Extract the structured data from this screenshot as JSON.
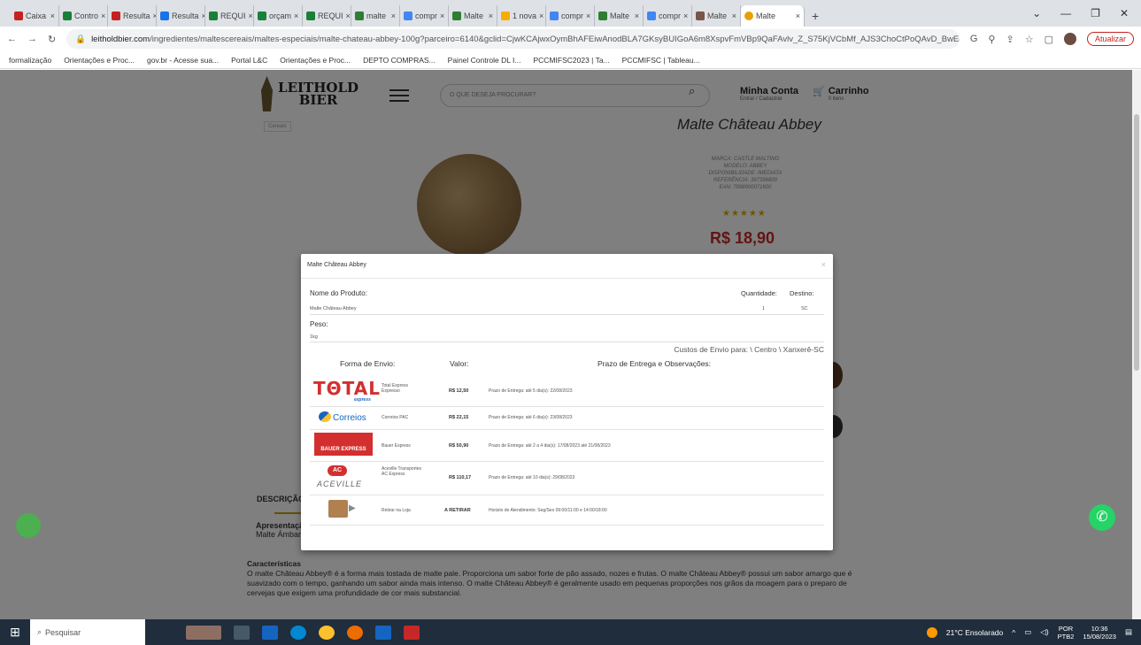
{
  "browser": {
    "tabs": [
      {
        "label": "Caixa"
      },
      {
        "label": "Contro"
      },
      {
        "label": "Resulta"
      },
      {
        "label": "Resulta"
      },
      {
        "label": "REQUI"
      },
      {
        "label": "orçam"
      },
      {
        "label": "REQUI"
      },
      {
        "label": "malte"
      },
      {
        "label": "compr"
      },
      {
        "label": "Malte"
      },
      {
        "label": "1 nova"
      },
      {
        "label": "compr"
      },
      {
        "label": "Malte"
      },
      {
        "label": "compr"
      },
      {
        "label": "Malte"
      },
      {
        "label": "Malte",
        "active": true
      }
    ],
    "url_domain": "leitholdbier.com",
    "url_rest": "/ingredientes/maltescereais/maltes-especiais/malte-chateau-abbey-100g?parceiro=6140&gclid=CjwKCAjwxOymBhAFEiwAnodBLA7GKsyBUIGoA6m8XspvFmVBp9QaFAvlv_Z_S75KjVCbMf_AJS3ChoCtPoQAvD_BwE&variant_...",
    "update_label": "Atualizar",
    "bookmarks": [
      "formalização",
      "Orientações e Proc...",
      "gov.br - Acesse sua...",
      "Portal L&C",
      "Orientações e Proc...",
      "DEPTO COMPRAS...",
      "Painel Controle DL I...",
      "PCCMIFSC2023 | Ta...",
      "PCCMIFSC | Tableau..."
    ]
  },
  "site": {
    "logo_line1": "LEITHOLD",
    "logo_line2": "BIER",
    "search_placeholder": "O QUE DESEJA PROCURAR?",
    "account_title": "Minha Conta",
    "account_sub": "Entrar / Cadastrar",
    "cart_title": "Carrinho",
    "cart_sub": "0 itens",
    "breadcrumb": "Cereais",
    "product_title": "Malte Château Abbey",
    "specs": [
      "MARCA: CASTLE MALTING",
      "MODELO: ABBEY",
      "DISPONIBILIDADE: IMEDIATA",
      "REFERÊNCIA: 397396800",
      "EAN: 7898900071600"
    ],
    "stars": "★★★★★",
    "price": "R$ 18,90",
    "desc_label": "DESCRIÇÃO",
    "apres_title": "Apresentação",
    "apres_text": "Malte Ámbar",
    "caract_title": "Características",
    "caract_text": "O malte Château Abbey® é a forma mais tostada de malte pale. Proporciona um sabor forte de pão assado, nozes e frutas. O malte Château Abbey® possui um sabor amargo que é suavizado com o tempo, ganhando um sabor ainda mais intenso. O malte Château Abbey® é geralmente usado em pequenas proporções nos grãos da moagem para o preparo de cervejas que exigem uma profundidade de cor mais substancial."
  },
  "modal": {
    "title": "Malte Château Abbey",
    "close": "×",
    "product_label": "Nome do Produto:",
    "product_value": "Malte Château Abbey",
    "qty_label": "Quantidade:",
    "qty_value": "1",
    "dest_label": "Destino:",
    "dest_value": "SC",
    "weight_label": "Peso:",
    "weight_value": "1kg",
    "shipping_title": "Custos de Envio para: \\ Centro \\ Xanxerê-SC",
    "col_method": "Forma de Envio:",
    "col_value": "Valor:",
    "col_deadline": "Prazo de Entrega e Observações:",
    "rows": [
      {
        "carrier": "TOTAL express",
        "service": "Total Express Expresso",
        "value": "R$ 12,50",
        "deadline": "Prazo de Entrega: até 5 dia(s): 22/08/2023"
      },
      {
        "carrier": "Correios",
        "service": "Correios PAC",
        "value": "R$ 22,15",
        "deadline": "Prazo de Entrega: até 6 dia(s): 23/08/2023"
      },
      {
        "carrier": "BAUER EXPRESS",
        "service": "Bauer Express",
        "value": "R$ 50,90",
        "deadline": "Prazo de Entrega: até 2 a 4 dia(s): 17/08/2023 até 21/08/2023"
      },
      {
        "carrier": "ACEVILLE",
        "service": "Aceville Transportes AC Express",
        "value": "R$ 110,17",
        "deadline": "Prazo de Entrega: até 10 dia(s): 29/08/2023"
      },
      {
        "carrier": "Retirar",
        "service": "Retirar na Loja",
        "value": "A RETIRAR",
        "deadline": "Horário de Atendimento: Seg/Sex 09:00/11:00 e 14:00/18:00"
      }
    ]
  },
  "taskbar": {
    "search": "Pesquisar",
    "weather": "21°C Ensolarado",
    "lang1": "POR",
    "lang2": "PTB2",
    "time": "10:36",
    "date": "15/08/2023"
  }
}
